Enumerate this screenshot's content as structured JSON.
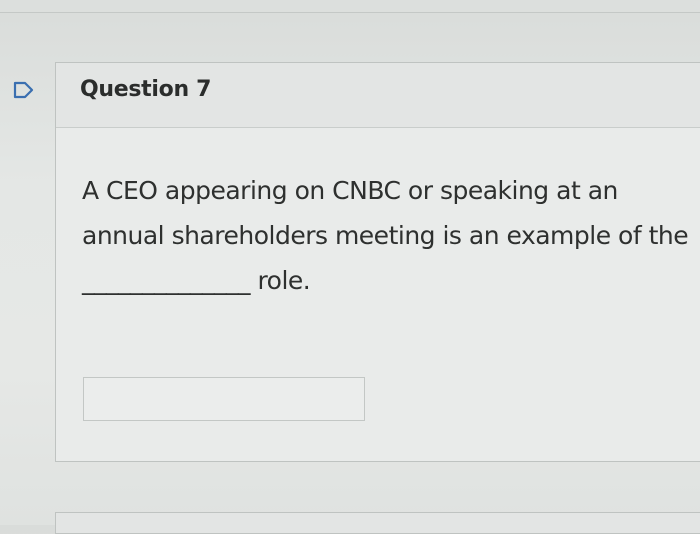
{
  "question": {
    "title": "Question 7",
    "text": "A CEO appearing on CNBC or speaking at an annual shareholders meeting is an example of the ______________ role.",
    "answer_value": "",
    "answer_placeholder": ""
  },
  "icons": {
    "flag": "flag-icon"
  },
  "colors": {
    "flag": "#3a6fb0"
  }
}
